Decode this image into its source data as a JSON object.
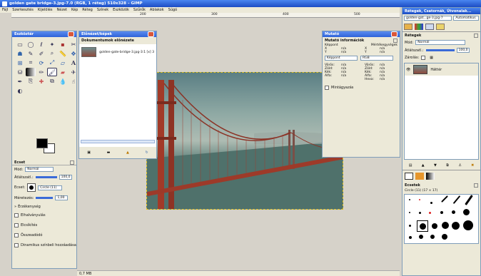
{
  "window": {
    "title": "golden gate bridge-3.jpg-7.0 (RGB, 1 réteg) 510x328 – GIMP"
  },
  "menubar": [
    "Fájl",
    "Szerkesztés",
    "Kijelölés",
    "Nézet",
    "Kép",
    "Réteg",
    "Színek",
    "Eszközök",
    "Szűrők",
    "Ablakok",
    "Súgó"
  ],
  "rulers": {
    "top": [
      "200",
      "300",
      "400",
      "500"
    ]
  },
  "toolbox": {
    "title": "Eszköztár",
    "tools": [
      "rect-select",
      "ellipse-select",
      "lasso",
      "fuzzy-select",
      "by-color",
      "scissors",
      "foreground-select",
      "paths",
      "color-picker",
      "zoom",
      "measure",
      "move",
      "align",
      "crop",
      "rotate",
      "scale",
      "shear",
      "perspective",
      "flip",
      "text",
      "bucket",
      "blend",
      "pencil",
      "paintbrush",
      "eraser",
      "airbrush",
      "ink",
      "clone",
      "heal",
      "perspective-clone",
      "blur",
      "smudge",
      "dodge"
    ],
    "fg_color": "#000000",
    "bg_color": "#ffffff"
  },
  "brush_options": {
    "title": "Ecset",
    "mode_label": "Mód:",
    "mode_value": "Normál",
    "opacity_label": "Átlátszatl.:",
    "opacity_value": "100,0",
    "brush_label": "Ecset:",
    "brush_value": "Circle (11)",
    "scale_label": "Méretezés:",
    "scale_value": "1,00",
    "options": [
      "Érzékenység",
      "Elhalványulás",
      "Elcsíkítés",
      "Összeadódó",
      "Dinamikus színbeli hozzáadása"
    ]
  },
  "image_window": {
    "title": "Előnézet/képek",
    "header": "Dokumentumok előnézete",
    "thumb_label": "golden-gate-bridge-3.jpg-3:1 [x] 3"
  },
  "pointer": {
    "title": "Mutató",
    "header": "Mutató információk",
    "col1_title": "Képpont",
    "col2_title": "Mértékegységek",
    "x_label": "X",
    "y_label": "Y",
    "xy_value": "n/a",
    "mode1": "Képpont",
    "mode2": "RGB",
    "rows": [
      [
        "Vörös:",
        "n/a",
        "Vörös:",
        "n/a"
      ],
      [
        "Zöld:",
        "n/a",
        "Zöld:",
        "n/a"
      ],
      [
        "Kék:",
        "n/a",
        "Kék:",
        "n/a"
      ],
      [
        "Alfa:",
        "n/a",
        "Alfa:",
        "n/a"
      ],
      [
        "",
        "",
        "Hexa:",
        "n/a"
      ]
    ],
    "sample_merged": "Mintágyazás"
  },
  "status": {
    "size": "0,7 MB"
  },
  "right_dock": {
    "title": "Rétegek, Csatornák, Útvonalak...",
    "image_selector": "golden-gat...ge-3.jpg-7",
    "auto_label": "Automatikus",
    "layers_title": "Rétegek",
    "mode_label": "Mód:",
    "mode_value": "Normál",
    "opacity_label": "Átlátszatl.:",
    "opacity_value": "100,0",
    "lock_label": "Zárolás:",
    "layer_name": "Háttér",
    "brushes_title": "Ecsetek",
    "brushes_sub": "Circle (11) (17 × 17)"
  },
  "colors": {
    "accent": "#2e63d9",
    "panel": "#ece9d8",
    "canvas": "#d6d2c9"
  }
}
